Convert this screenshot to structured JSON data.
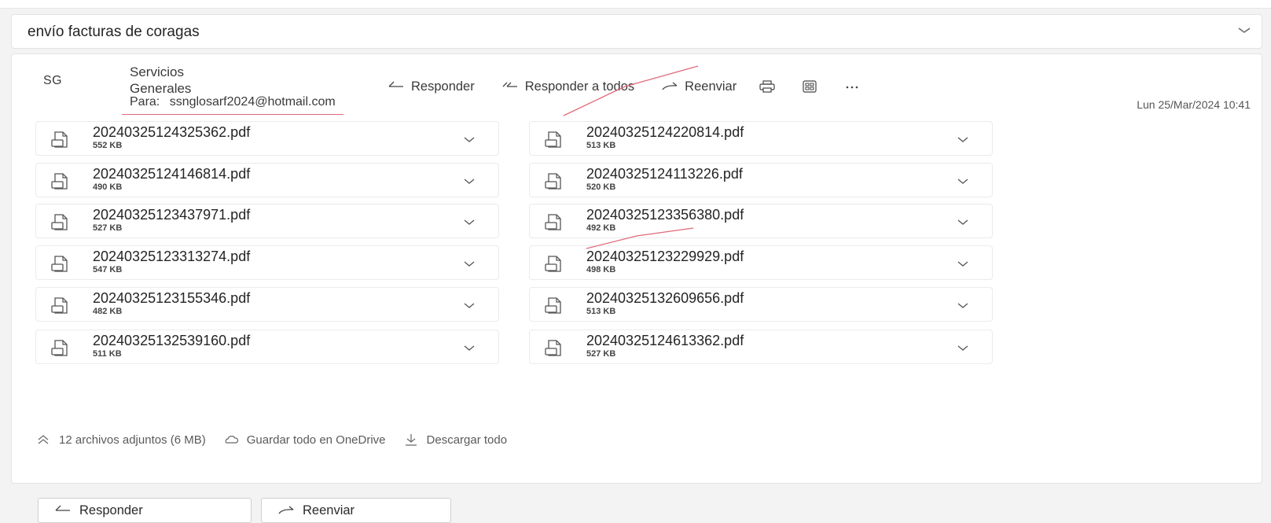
{
  "subject": "envío facturas de coragas",
  "sender": {
    "initials": "SG",
    "name": "Servicios Generales",
    "to_label": "Para:",
    "to_email": "ssnglosarf2024@hotmail.com",
    "datetime": "Lun 25/Mar/2024 10:41"
  },
  "toolbar": {
    "reply": "Responder",
    "reply_all": "Responder a todos",
    "forward": "Reenviar"
  },
  "attachments": [
    {
      "name": "20240325124325362.pdf",
      "size": "552 KB"
    },
    {
      "name": "20240325124220814.pdf",
      "size": "513 KB"
    },
    {
      "name": "20240325124146814.pdf",
      "size": "490 KB"
    },
    {
      "name": "20240325124113226.pdf",
      "size": "520 KB"
    },
    {
      "name": "20240325123437971.pdf",
      "size": "527 KB"
    },
    {
      "name": "20240325123356380.pdf",
      "size": "492 KB"
    },
    {
      "name": "20240325123313274.pdf",
      "size": "547 KB"
    },
    {
      "name": "20240325123229929.pdf",
      "size": "498 KB"
    },
    {
      "name": "20240325123155346.pdf",
      "size": "482 KB"
    },
    {
      "name": "20240325132609656.pdf",
      "size": "513 KB"
    },
    {
      "name": "20240325132539160.pdf",
      "size": "511 KB"
    },
    {
      "name": "20240325124613362.pdf",
      "size": "527 KB"
    }
  ],
  "footer": {
    "summary": "12 archivos adjuntos (6 MB)",
    "save_onedrive": "Guardar todo en OneDrive",
    "download_all": "Descargar todo"
  },
  "bottom": {
    "reply": "Responder",
    "forward": "Reenviar"
  },
  "colors": {
    "annotation": "#e06a7a"
  }
}
